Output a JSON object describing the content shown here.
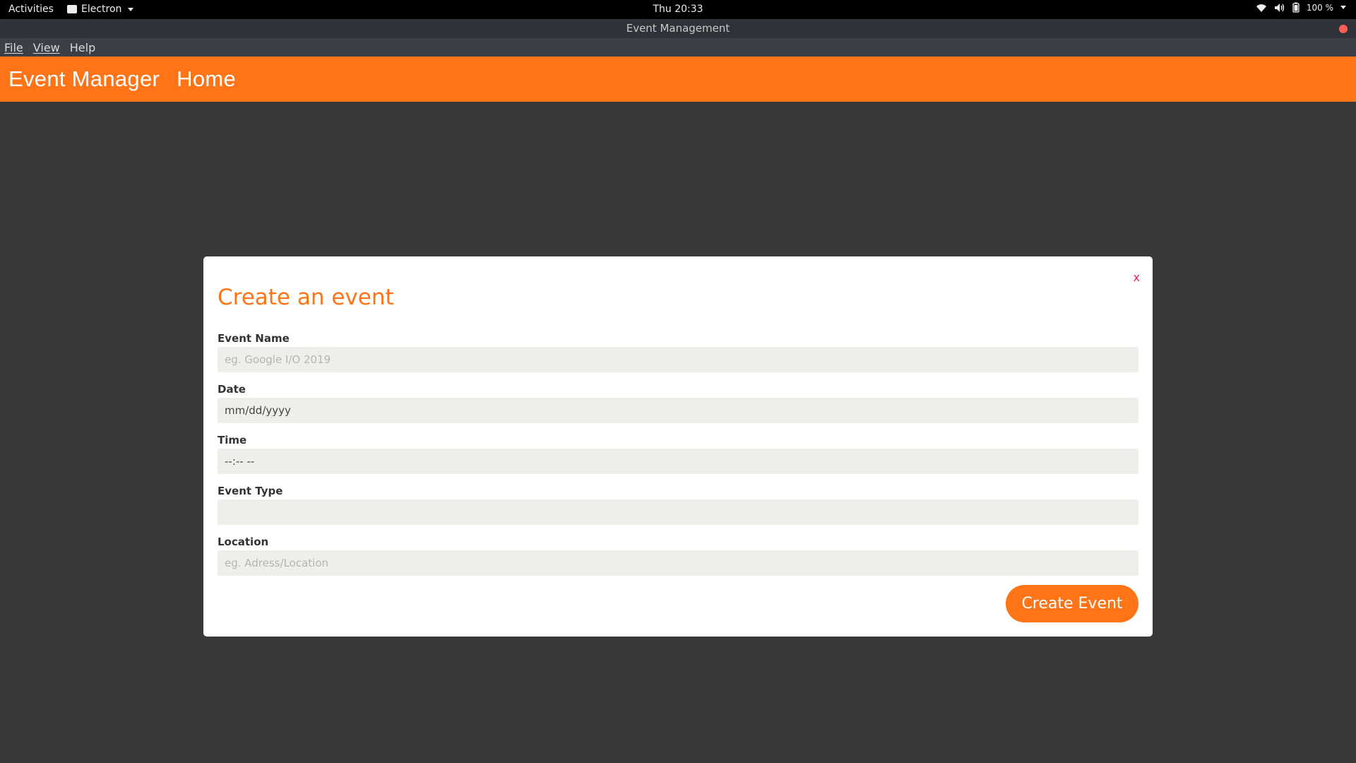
{
  "system_bar": {
    "activities": "Activities",
    "app_name": "Electron",
    "clock": "Thu 20:33",
    "battery": "100 %"
  },
  "window": {
    "title": "Event Management"
  },
  "menu": {
    "items": [
      "File",
      "View",
      "Help"
    ]
  },
  "header": {
    "brand": "Event Manager",
    "nav_home": "Home"
  },
  "modal": {
    "title": "Create an event",
    "close": "x",
    "fields": [
      {
        "label": "Event Name",
        "placeholder": "eg. Google I/O 2019",
        "value": ""
      },
      {
        "label": "Date",
        "placeholder": "",
        "value": "mm/dd/yyyy"
      },
      {
        "label": "Time",
        "placeholder": "",
        "value": "--:-- --"
      },
      {
        "label": "Event Type",
        "placeholder": "",
        "value": ""
      },
      {
        "label": "Location",
        "placeholder": "eg. Adress/Location",
        "value": ""
      }
    ],
    "submit": "Create Event"
  },
  "colors": {
    "accent": "#ff7417",
    "close": "#e0245e",
    "input_bg": "#eeefea",
    "backdrop": "#393939"
  }
}
